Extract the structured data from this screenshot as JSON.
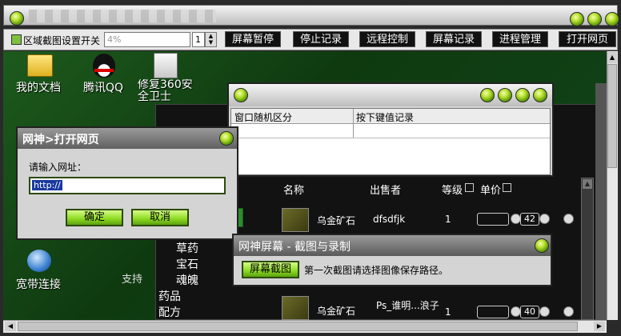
{
  "toolbar": {
    "region_label": "区域截图设置开关",
    "region_input_value": "4%",
    "stepper_value": "1",
    "buttons": [
      "屏幕暂停",
      "停止记录",
      "远程控制",
      "屏幕记录",
      "进程管理",
      "打开网页"
    ]
  },
  "desktop": {
    "icons": [
      {
        "label": "我的文档",
        "icon": "folder-icon"
      },
      {
        "label": "腾讯QQ",
        "icon": "penguin-icon"
      },
      {
        "label": "修复360安全卫士",
        "icon": "shield-icon"
      },
      {
        "label": "宽带连接",
        "icon": "network-icon"
      }
    ]
  },
  "log_window": {
    "col_window": "窗口随机区分",
    "col_keys": "按下键值记录"
  },
  "url_dialog": {
    "title": "网神>打开网页",
    "prompt": "请输入网址：",
    "url_value": "http://",
    "ok_label": "确定",
    "cancel_label": "取消"
  },
  "capture_window": {
    "title": "网神屏幕 - 截图与录制",
    "capture_button": "屏幕截图",
    "hint": "第一次截图请选择图像保存路径。"
  },
  "game": {
    "headers": [
      "名称",
      "出售者",
      "等级",
      "单价"
    ],
    "rows": [
      {
        "name": "乌金矿石",
        "seller": "dfsdfjk",
        "level": "1",
        "price": "42"
      },
      {
        "name": "乌金矿石",
        "seller": "Ps_谁明...浪子",
        "level": "1",
        "price": "40"
      }
    ],
    "side_items": [
      "草药",
      "宝石",
      "魂魄",
      "药品",
      "配方"
    ],
    "support_text": "支持"
  },
  "colors": {
    "toolbar_button_bg": "#111111",
    "accent_green": "#8bd820",
    "game_bg": "#121212"
  }
}
